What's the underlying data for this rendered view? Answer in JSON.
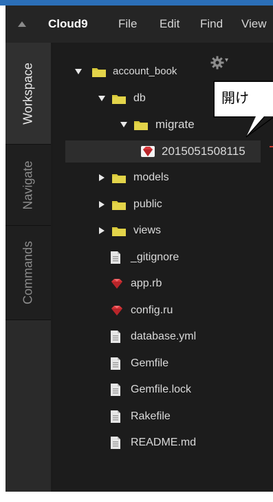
{
  "menubar": {
    "collapse_icon": "triangle-up-icon",
    "items": [
      {
        "label": "Cloud9"
      },
      {
        "label": "File"
      },
      {
        "label": "Edit"
      },
      {
        "label": "Find"
      },
      {
        "label": "View"
      }
    ]
  },
  "sidebar": {
    "tabs": [
      {
        "label": "Workspace",
        "active": true
      },
      {
        "label": "Navigate",
        "active": false
      },
      {
        "label": "Commands",
        "active": false
      }
    ]
  },
  "toolbar": {
    "settings_icon": "gear-icon"
  },
  "tree": {
    "items": [
      {
        "label": "account_book",
        "type": "folder",
        "state": "expanded",
        "level": 0
      },
      {
        "label": "db",
        "type": "folder",
        "state": "expanded",
        "level": 1
      },
      {
        "label": "migrate",
        "type": "folder",
        "state": "expanded",
        "level": 2
      },
      {
        "label": "2015051508115",
        "type": "ruby",
        "state": "selected",
        "level": 3
      },
      {
        "label": "models",
        "type": "folder",
        "state": "collapsed",
        "level": 1
      },
      {
        "label": "public",
        "type": "folder",
        "state": "collapsed",
        "level": 1
      },
      {
        "label": "views",
        "type": "folder",
        "state": "collapsed",
        "level": 1
      },
      {
        "label": "_gitignore",
        "type": "file",
        "level": 1
      },
      {
        "label": "app.rb",
        "type": "ruby",
        "level": 1
      },
      {
        "label": "config.ru",
        "type": "ruby",
        "level": 1
      },
      {
        "label": "database.yml",
        "type": "file",
        "level": 1
      },
      {
        "label": "Gemfile",
        "type": "file",
        "level": 1
      },
      {
        "label": "Gemfile.lock",
        "type": "file",
        "level": 1
      },
      {
        "label": "Rakefile",
        "type": "file",
        "level": 1
      },
      {
        "label": "README.md",
        "type": "file",
        "level": 1
      }
    ]
  },
  "callout": {
    "text": "開け"
  },
  "colors": {
    "accent_blue": "#2b6fb8",
    "folder_yellow": "#d8c93a",
    "ruby_red": "#d9363a",
    "panel_bg": "#1c1c1c",
    "menubar_bg": "#252525"
  }
}
